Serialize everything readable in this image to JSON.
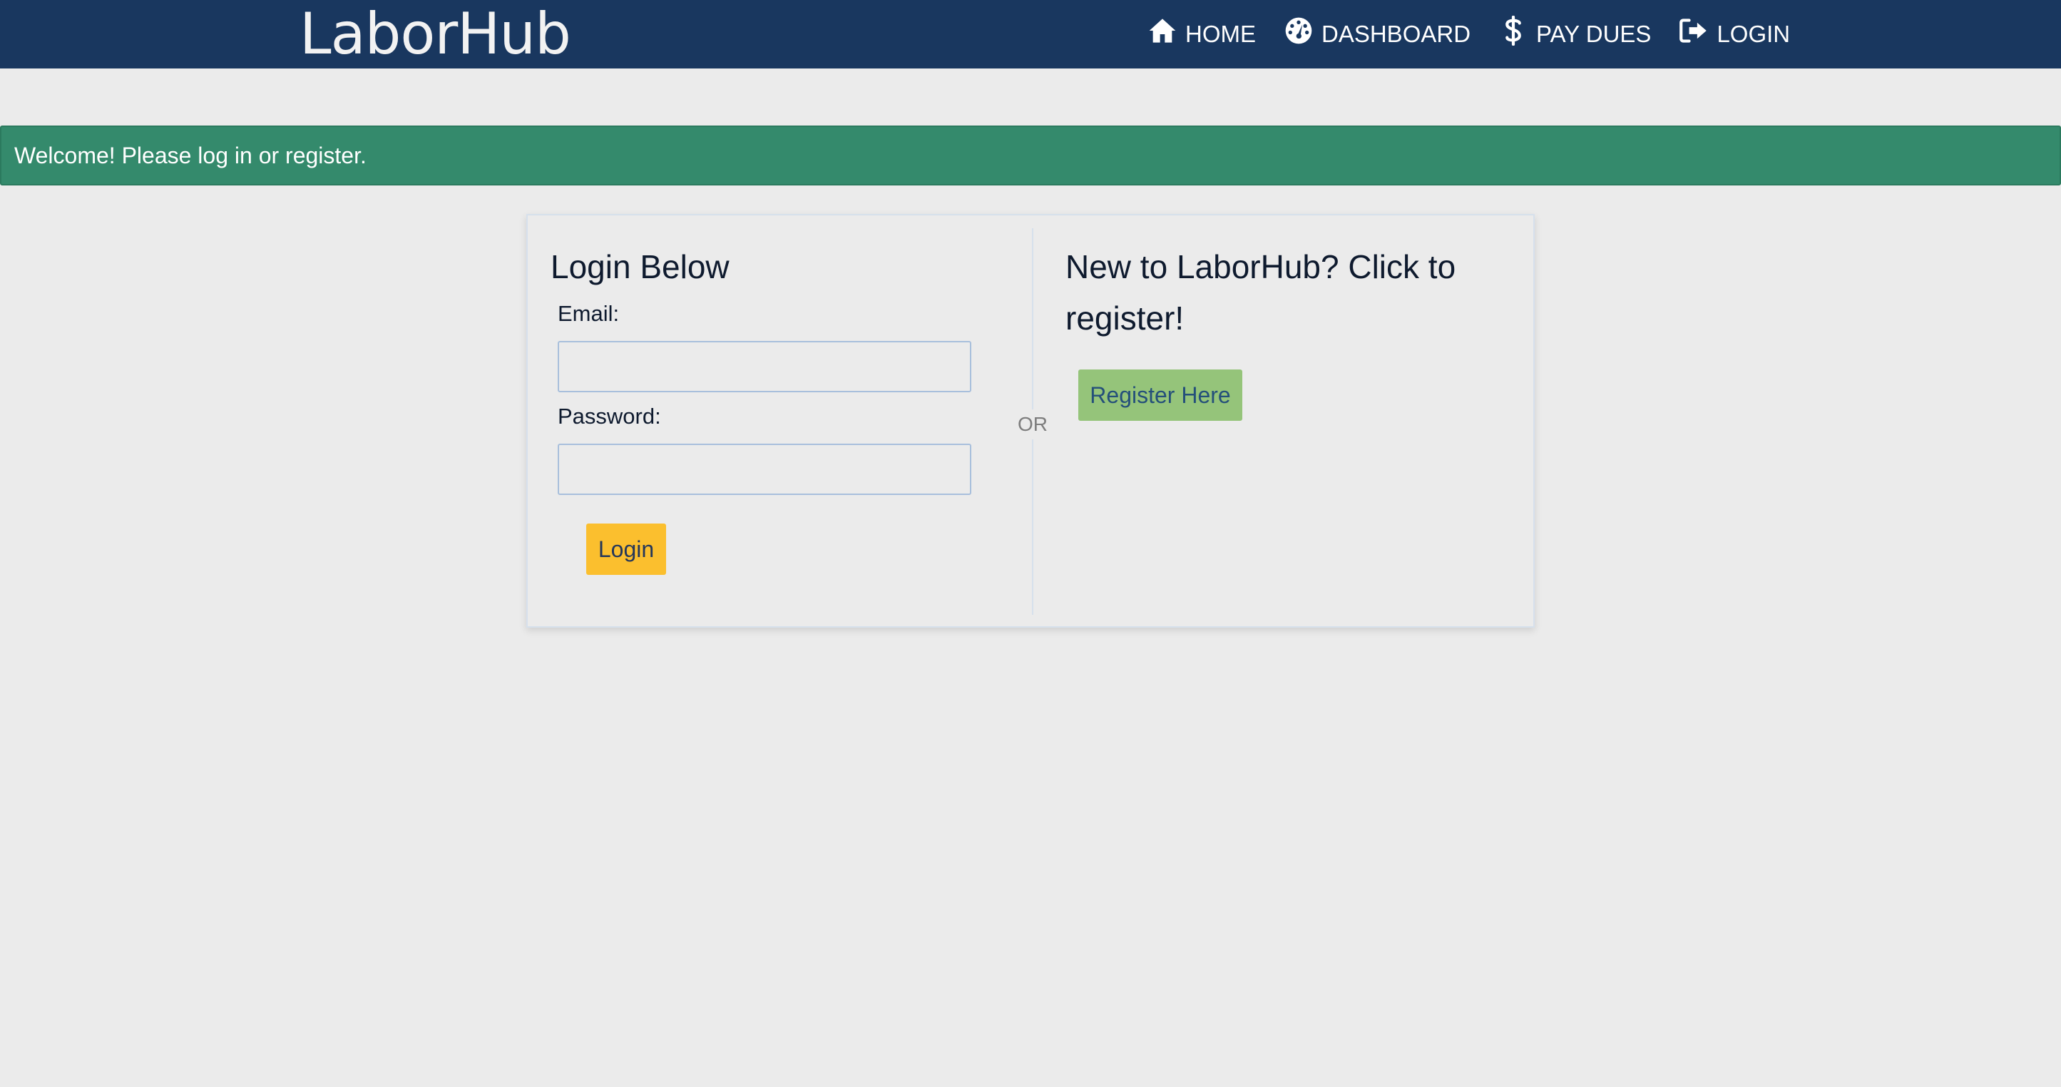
{
  "navbar": {
    "brand": "LaborHub",
    "background_color": "#19375f",
    "items": [
      {
        "label": "HOME",
        "icon": "home-icon"
      },
      {
        "label": "DASHBOARD",
        "icon": "dashboard-icon"
      },
      {
        "label": "PAY DUES",
        "icon": "dollar-icon"
      },
      {
        "label": "LOGIN",
        "icon": "login-icon"
      }
    ]
  },
  "flash": {
    "message": "Welcome! Please log in or register.",
    "color": "#348a6c"
  },
  "login": {
    "heading": "Login Below",
    "email_label": "Email:",
    "email_value": "",
    "password_label": "Password:",
    "password_value": "",
    "button_label": "Login",
    "button_color": "#fbbf2e"
  },
  "separator": {
    "label": "OR"
  },
  "register": {
    "heading": "New to LaborHub? Click to register!",
    "button_label": "Register Here",
    "button_color": "#95c47a"
  }
}
